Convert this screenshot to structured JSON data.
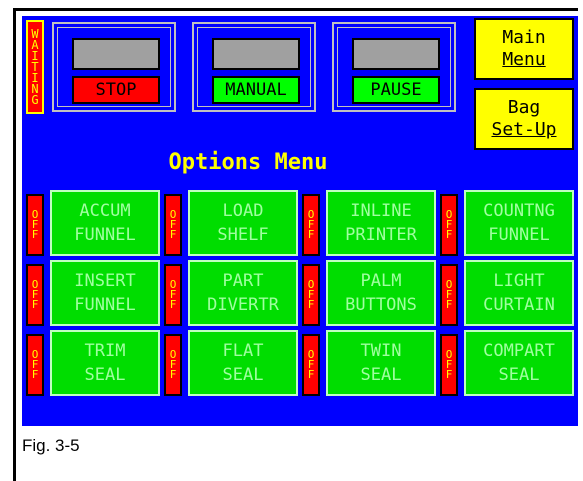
{
  "status": {
    "text": [
      "W",
      "A",
      "I",
      "T",
      "I",
      "N",
      "G"
    ]
  },
  "controls": [
    {
      "label": "STOP",
      "color": "#ff0000"
    },
    {
      "label": "MANUAL",
      "color": "#00ff00"
    },
    {
      "label": "PAUSE",
      "color": "#00ff00"
    }
  ],
  "side": {
    "main_menu": [
      "Main",
      "Menu"
    ],
    "bag_setup": [
      "Bag",
      "Set-Up"
    ]
  },
  "title": "Options Menu",
  "off_label": [
    "O",
    "F",
    "F"
  ],
  "options": [
    [
      "ACCUM",
      "FUNNEL"
    ],
    [
      "LOAD",
      "SHELF"
    ],
    [
      "INLINE",
      "PRINTER"
    ],
    [
      "COUNTNG",
      "FUNNEL"
    ],
    [
      "INSERT",
      "FUNNEL"
    ],
    [
      "PART",
      "DIVERTR"
    ],
    [
      "PALM",
      "BUTTONS"
    ],
    [
      "LIGHT",
      "CURTAIN"
    ],
    [
      "TRIM",
      "SEAL"
    ],
    [
      "FLAT",
      "SEAL"
    ],
    [
      "TWIN",
      "SEAL"
    ],
    [
      "COMPART",
      "SEAL"
    ]
  ],
  "caption": "Fig. 3-5",
  "colors": {
    "screen": "#0000ff",
    "option_green": "#00dd00",
    "off_red": "#ff0000",
    "menu_yellow": "#ffff00"
  }
}
